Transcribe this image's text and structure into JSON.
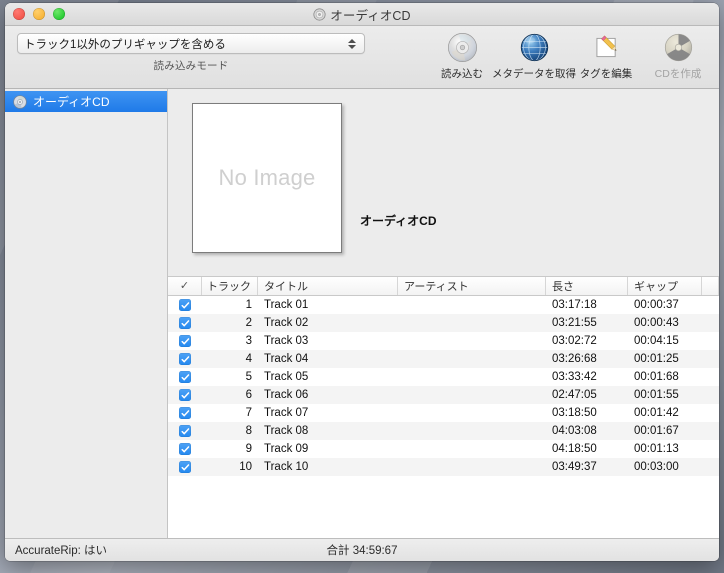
{
  "window": {
    "title": "オーディオCD",
    "title_icon": "cd-disc-icon",
    "traffic_lights": [
      "close",
      "minimize",
      "zoom"
    ]
  },
  "toolbar": {
    "read_mode": {
      "selected_option": "トラック1以外のプリギャップを含める",
      "caption": "読み込みモード"
    },
    "buttons": [
      {
        "label": "読み込む",
        "icon": "cd-disc-icon",
        "disabled": false
      },
      {
        "label": "メタデータを取得",
        "icon": "globe-icon",
        "disabled": false
      },
      {
        "label": "タグを編集",
        "icon": "pencil-note-icon",
        "disabled": false
      },
      {
        "label": "CDを作成",
        "icon": "burn-disc-icon",
        "disabled": true
      }
    ]
  },
  "sidebar": {
    "items": [
      {
        "label": "オーディオCD",
        "icon": "cd-disc-icon",
        "selected": true
      }
    ]
  },
  "album": {
    "artwork_placeholder": "No Image",
    "title": "オーディオCD"
  },
  "table": {
    "columns": [
      "✓",
      "トラック",
      "タイトル",
      "アーティスト",
      "長さ",
      "ギャップ"
    ],
    "rows": [
      {
        "checked": true,
        "num": "1",
        "title": "Track 01",
        "artist": "",
        "length": "03:17:18",
        "gap": "00:00:37"
      },
      {
        "checked": true,
        "num": "2",
        "title": "Track 02",
        "artist": "",
        "length": "03:21:55",
        "gap": "00:00:43"
      },
      {
        "checked": true,
        "num": "3",
        "title": "Track 03",
        "artist": "",
        "length": "03:02:72",
        "gap": "00:04:15"
      },
      {
        "checked": true,
        "num": "4",
        "title": "Track 04",
        "artist": "",
        "length": "03:26:68",
        "gap": "00:01:25"
      },
      {
        "checked": true,
        "num": "5",
        "title": "Track 05",
        "artist": "",
        "length": "03:33:42",
        "gap": "00:01:68"
      },
      {
        "checked": true,
        "num": "6",
        "title": "Track 06",
        "artist": "",
        "length": "02:47:05",
        "gap": "00:01:55"
      },
      {
        "checked": true,
        "num": "7",
        "title": "Track 07",
        "artist": "",
        "length": "03:18:50",
        "gap": "00:01:42"
      },
      {
        "checked": true,
        "num": "8",
        "title": "Track 08",
        "artist": "",
        "length": "04:03:08",
        "gap": "00:01:67"
      },
      {
        "checked": true,
        "num": "9",
        "title": "Track 09",
        "artist": "",
        "length": "04:18:50",
        "gap": "00:01:13"
      },
      {
        "checked": true,
        "num": "10",
        "title": "Track 10",
        "artist": "",
        "length": "03:49:37",
        "gap": "00:03:00"
      }
    ]
  },
  "statusbar": {
    "accuraterip": "AccurateRip: はい",
    "total": "合計 34:59:67"
  },
  "colors": {
    "selection_blue": "#1f7ae8",
    "checkbox_blue": "#2489f0",
    "window_chrome": "#ececec"
  }
}
